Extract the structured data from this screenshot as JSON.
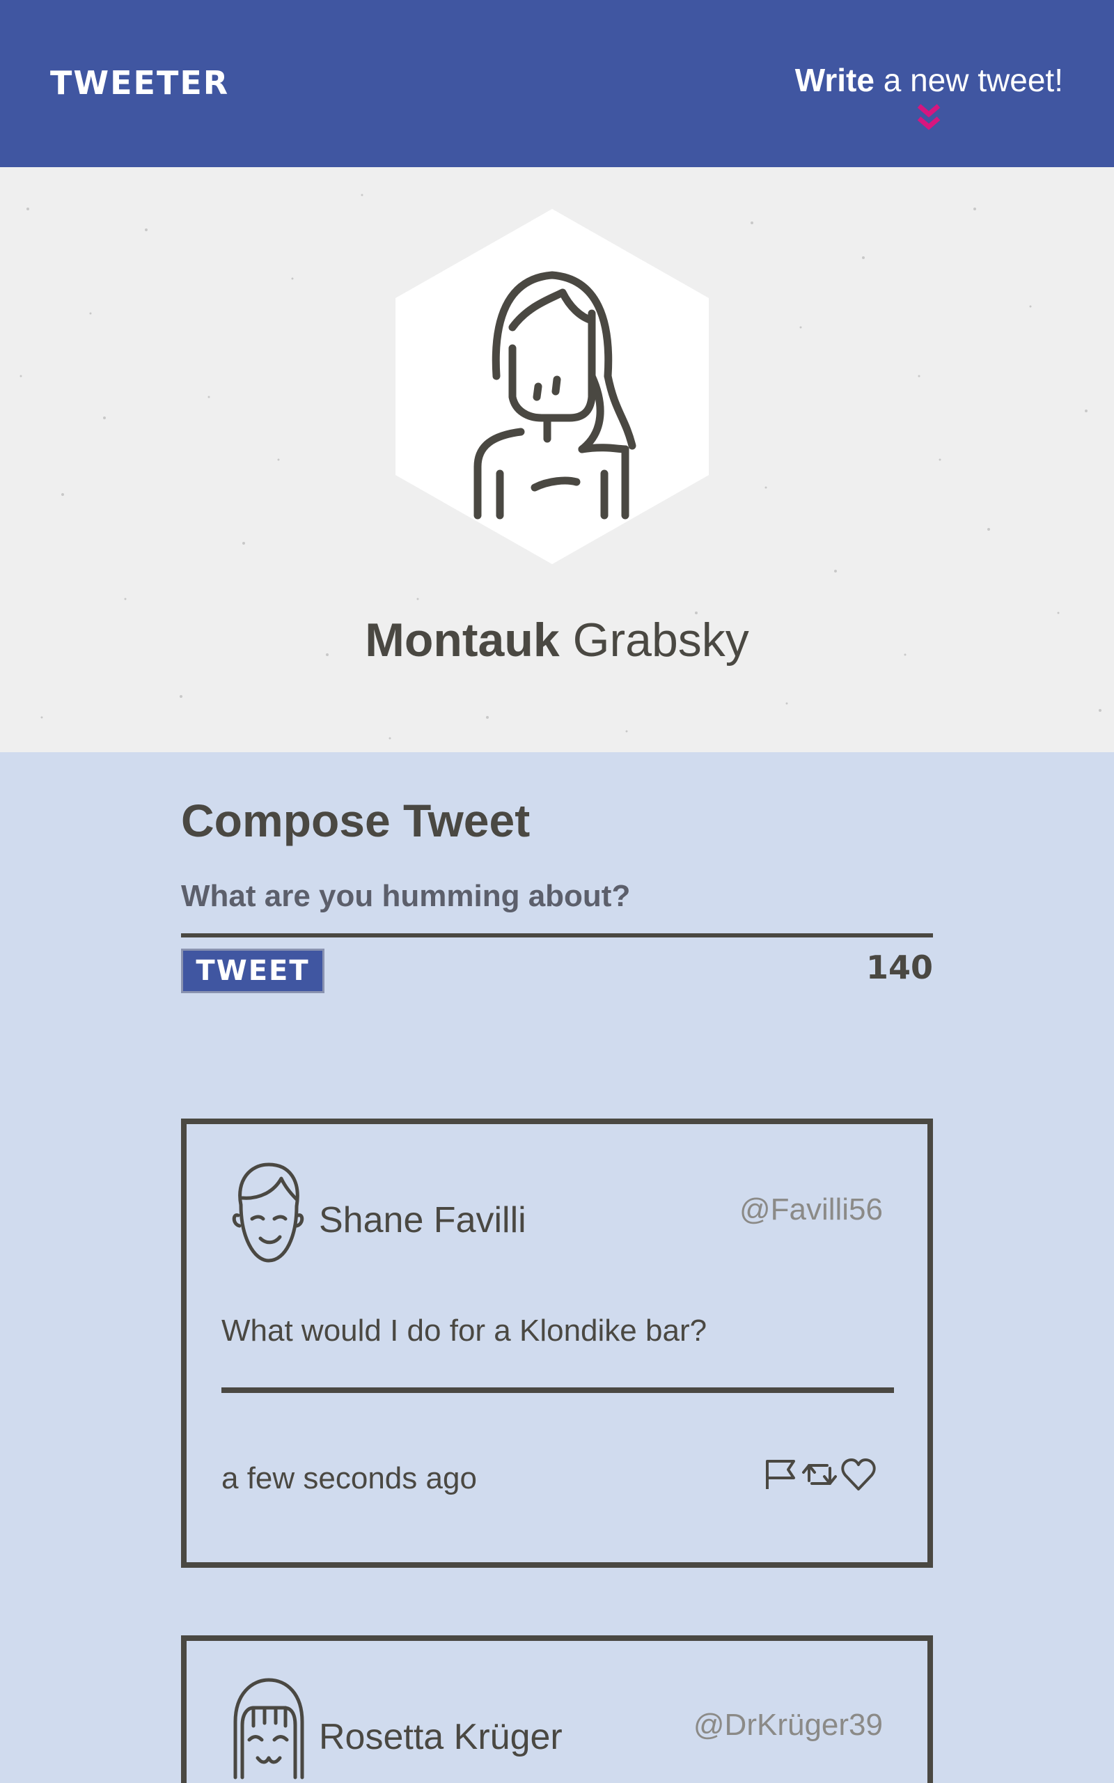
{
  "nav": {
    "logo": "TWEETER",
    "write_bold": "Write",
    "write_rest": " a new tweet!",
    "accent_color": "#d6167f"
  },
  "profile": {
    "first_name": "Montauk",
    "last_name": " Grabsky"
  },
  "compose": {
    "title": "Compose Tweet",
    "placeholder": "What are you humming about?",
    "button_label": "TWEET",
    "counter": "140"
  },
  "tweets": [
    {
      "name": "Shane Favilli",
      "handle": "@Favilli56",
      "content": "What would I do for a Klondike bar?",
      "time": "a few seconds ago",
      "actions": [
        "flag-icon",
        "retweet-icon",
        "heart-icon"
      ]
    },
    {
      "name": "Rosetta Krüger",
      "handle": "@DrKrüger39"
    }
  ],
  "colors": {
    "nav": "#4056a1",
    "background": "#d0dbee",
    "header": "#efefef",
    "text": "#4a4842"
  }
}
